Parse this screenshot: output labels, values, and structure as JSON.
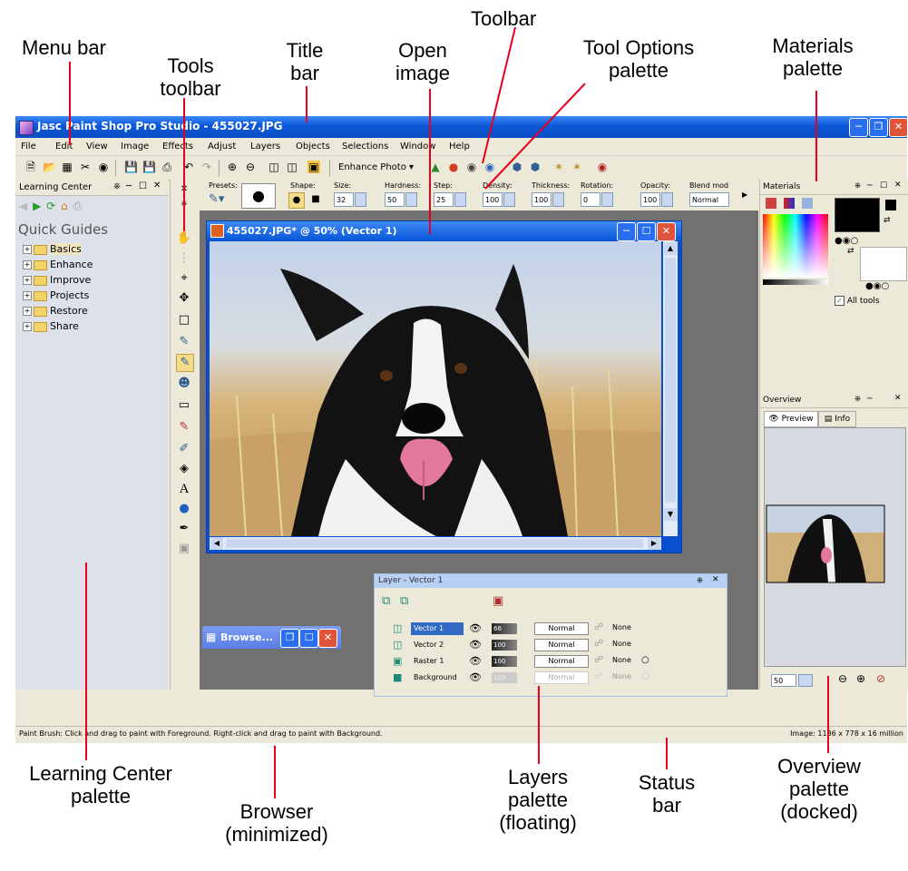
{
  "callouts": {
    "toolbar": "Toolbar",
    "menu_bar": "Menu bar",
    "title_bar_1": "Title",
    "title_bar_2": "bar",
    "open_image_1": "Open",
    "open_image_2": "image",
    "tool_options_1": "Tool Options",
    "tool_options_2": "palette",
    "materials_1": "Materials",
    "materials_2": "palette",
    "tools_toolbar_1": "Tools",
    "tools_toolbar_2": "toolbar",
    "learning_center_1": "Learning Center",
    "learning_center_2": "palette",
    "browser_1": "Browser",
    "browser_2": "(minimized)",
    "layers_1": "Layers",
    "layers_2": "palette",
    "layers_3": "(floating)",
    "status_1": "Status",
    "status_2": "bar",
    "overview_1": "Overview",
    "overview_2": "palette",
    "overview_3": "(docked)"
  },
  "app": {
    "title": "Jasc Paint Shop Pro Studio - 455027.JPG",
    "menu": [
      "File",
      "Edit",
      "View",
      "Image",
      "Effects",
      "Adjust",
      "Layers",
      "Objects",
      "Selections",
      "Window",
      "Help"
    ],
    "enhance_photo": "Enhance Photo"
  },
  "learning_center": {
    "title": "Learning Center",
    "heading": "Quick Guides",
    "items": [
      "Basics",
      "Enhance",
      "Improve",
      "Projects",
      "Restore",
      "Share"
    ]
  },
  "tool_options": {
    "presets": "Presets:",
    "shape": "Shape:",
    "size": "Size:",
    "size_val": "32",
    "hardness": "Hardness:",
    "hardness_val": "50",
    "step": "Step:",
    "step_val": "25",
    "density": "Density:",
    "density_val": "100",
    "thickness": "Thickness:",
    "thickness_val": "100",
    "rotation": "Rotation:",
    "rotation_val": "0",
    "opacity": "Opacity:",
    "opacity_val": "100",
    "blend": "Blend mod",
    "blend_val": "Normal"
  },
  "document": {
    "title": "455027.JPG* @  50% (Vector 1)"
  },
  "layers": {
    "title": "Layer - Vector 1",
    "rows": [
      {
        "name": "Vector 1",
        "opacity": "66",
        "blend": "Normal",
        "mask": "None"
      },
      {
        "name": "Vector 2",
        "opacity": "100",
        "blend": "Normal",
        "mask": "None"
      },
      {
        "name": "Raster 1",
        "opacity": "100",
        "blend": "Normal",
        "mask": "None"
      },
      {
        "name": "Background",
        "opacity": "100",
        "blend": "Normal",
        "mask": "None"
      }
    ]
  },
  "browser": {
    "title": "Browse..."
  },
  "materials": {
    "title": "Materials",
    "all_tools": "All tools"
  },
  "overview": {
    "title": "Overview",
    "tab_preview": "Preview",
    "tab_info": "Info",
    "zoom": "50"
  },
  "status": {
    "left": "Paint Brush: Click and drag to paint with Foreground. Right-click and drag to paint with Background.",
    "right": "Image:  1186 x 778 x 16 million"
  }
}
